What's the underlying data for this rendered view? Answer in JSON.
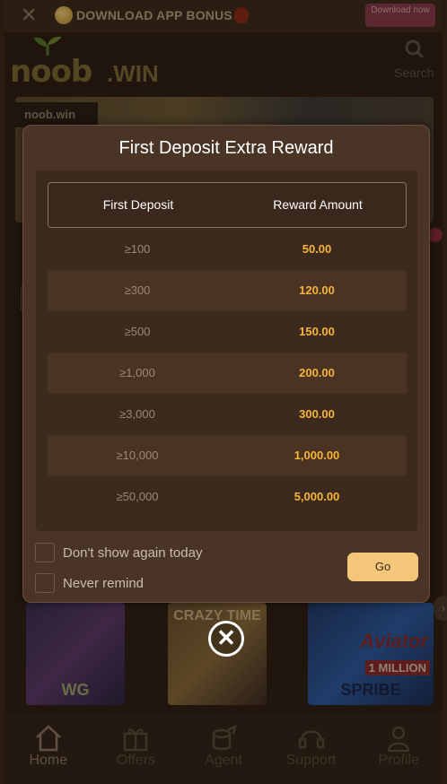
{
  "top_banner": {
    "close_glyph": "✕",
    "text": "DOWNLOAD APP  BONUS",
    "download_button": "Download now"
  },
  "header": {
    "logo_text": "noob",
    "logo_suffix": ".WIN",
    "search_label": "Search"
  },
  "hero": {
    "badge": "noob.win"
  },
  "games": [
    {
      "label": "WG"
    },
    {
      "label": "CRAZY TIME"
    },
    {
      "label": "SPRIBE",
      "badge": "1 MILLION",
      "title": "Aviator"
    }
  ],
  "bottom_nav": [
    {
      "label": "Home",
      "icon": "home-icon",
      "active": true
    },
    {
      "label": "Offers",
      "icon": "gift-icon"
    },
    {
      "label": "Agent",
      "icon": "agent-icon"
    },
    {
      "label": "Support",
      "icon": "headset-icon"
    },
    {
      "label": "Profile",
      "icon": "profile-icon"
    }
  ],
  "modal": {
    "title": "First Deposit Extra Reward",
    "columns": [
      "First Deposit",
      "Reward Amount"
    ],
    "rows": [
      {
        "deposit": "≥100",
        "reward": "50.00"
      },
      {
        "deposit": "≥300",
        "reward": "120.00"
      },
      {
        "deposit": "≥500",
        "reward": "150.00"
      },
      {
        "deposit": "≥1,000",
        "reward": "200.00"
      },
      {
        "deposit": "≥3,000",
        "reward": "300.00"
      },
      {
        "deposit": "≥10,000",
        "reward": "1,000.00"
      },
      {
        "deposit": "≥50,000",
        "reward": "5,000.00"
      }
    ],
    "dont_show_label": "Don't show again today",
    "never_remind_label": "Never remind",
    "go_label": "Go",
    "close_glyph": "✕"
  },
  "colors": {
    "modal_bg": "#4a3426",
    "reward_text": "#f5b53a",
    "go_button": "#f4c679"
  }
}
